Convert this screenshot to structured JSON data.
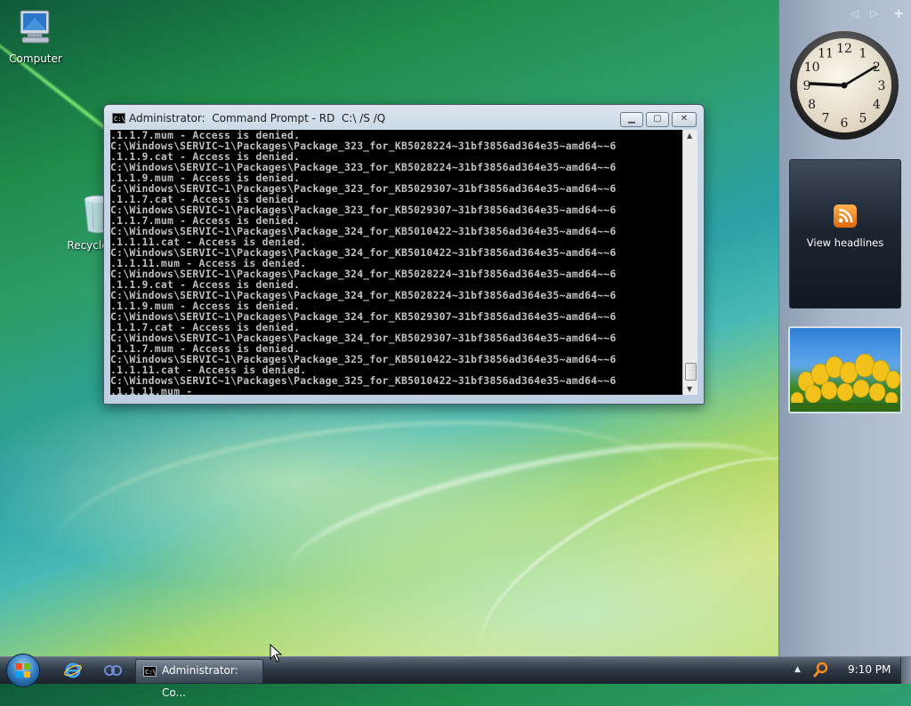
{
  "desktop": {
    "icons": [
      {
        "label": "Computer"
      },
      {
        "label": "Recycle Bin"
      }
    ]
  },
  "cmd_window": {
    "title": "Administrator:  Command Prompt - RD  C:\\ /S /Q",
    "controls": {
      "minimize": "▁",
      "maximize": "▢",
      "close": "✕"
    },
    "lines": [
      ".1.1.7.mum - Access is denied.",
      "C:\\Windows\\SERVIC~1\\Packages\\Package_323_for_KB5028224~31bf3856ad364e35~amd64~~6",
      ".1.1.9.cat - Access is denied.",
      "C:\\Windows\\SERVIC~1\\Packages\\Package_323_for_KB5028224~31bf3856ad364e35~amd64~~6",
      ".1.1.9.mum - Access is denied.",
      "C:\\Windows\\SERVIC~1\\Packages\\Package_323_for_KB5029307~31bf3856ad364e35~amd64~~6",
      ".1.1.7.cat - Access is denied.",
      "C:\\Windows\\SERVIC~1\\Packages\\Package_323_for_KB5029307~31bf3856ad364e35~amd64~~6",
      ".1.1.7.mum - Access is denied.",
      "C:\\Windows\\SERVIC~1\\Packages\\Package_324_for_KB5010422~31bf3856ad364e35~amd64~~6",
      ".1.1.11.cat - Access is denied.",
      "C:\\Windows\\SERVIC~1\\Packages\\Package_324_for_KB5010422~31bf3856ad364e35~amd64~~6",
      ".1.1.11.mum - Access is denied.",
      "C:\\Windows\\SERVIC~1\\Packages\\Package_324_for_KB5028224~31bf3856ad364e35~amd64~~6",
      ".1.1.9.cat - Access is denied.",
      "C:\\Windows\\SERVIC~1\\Packages\\Package_324_for_KB5028224~31bf3856ad364e35~amd64~~6",
      ".1.1.9.mum - Access is denied.",
      "C:\\Windows\\SERVIC~1\\Packages\\Package_324_for_KB5029307~31bf3856ad364e35~amd64~~6",
      ".1.1.7.cat - Access is denied.",
      "C:\\Windows\\SERVIC~1\\Packages\\Package_324_for_KB5029307~31bf3856ad364e35~amd64~~6",
      ".1.1.7.mum - Access is denied.",
      "C:\\Windows\\SERVIC~1\\Packages\\Package_325_for_KB5010422~31bf3856ad364e35~amd64~~6",
      ".1.1.11.cat - Access is denied.",
      "C:\\Windows\\SERVIC~1\\Packages\\Package_325_for_KB5010422~31bf3856ad364e35~amd64~~6",
      ".1.1.11.mum - "
    ]
  },
  "sidebar": {
    "controls": {
      "prev": "◁",
      "next": "▷",
      "add": "+"
    },
    "clock": {
      "numerals": [
        "12",
        "1",
        "2",
        "3",
        "4",
        "5",
        "6",
        "7",
        "8",
        "9",
        "10",
        "11"
      ],
      "time": "9:10"
    },
    "feed": {
      "label": "View headlines"
    }
  },
  "taskbar": {
    "task_label": "Administrator:  Co...",
    "tray_arrow": "▲",
    "time": "9:10 PM"
  },
  "colors": {
    "console_bg": "#000000",
    "console_text": "#c0c0c0",
    "rss_orange": "#f08a24"
  }
}
